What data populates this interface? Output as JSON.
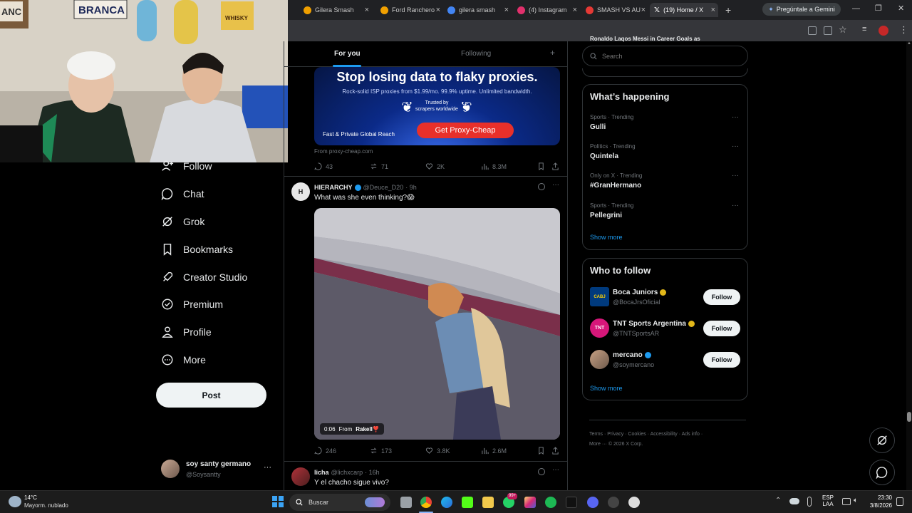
{
  "browser": {
    "tabs": [
      {
        "title": "Gilera Smash",
        "color": "#f0a000"
      },
      {
        "title": "Ford Ranchero",
        "color": "#f0a000"
      },
      {
        "title": "gilera smash",
        "color": "#4285f4"
      },
      {
        "title": "(4) Instagram",
        "color": "#e1306c"
      },
      {
        "title": "SMASH VS AU",
        "color": "#e53935"
      },
      {
        "title": "(19) Home / X",
        "color": "#ffffff"
      }
    ],
    "new_tab": "+",
    "gemini_label": "Pregúntale a Gemini",
    "window_controls": [
      "—",
      "❐",
      "✕"
    ]
  },
  "x": {
    "top_tabs": {
      "for_you": "For you",
      "following": "Following",
      "add": "+"
    },
    "nav": [
      {
        "label": "Follow",
        "icon": "person-plus-icon"
      },
      {
        "label": "Chat",
        "icon": "chat-icon"
      },
      {
        "label": "Grok",
        "icon": "grok-icon"
      },
      {
        "label": "Bookmarks",
        "icon": "bookmark-icon"
      },
      {
        "label": "Creator Studio",
        "icon": "rocket-icon"
      },
      {
        "label": "Premium",
        "icon": "verified-icon"
      },
      {
        "label": "Profile",
        "icon": "person-icon"
      },
      {
        "label": "More",
        "icon": "more-circle-icon"
      }
    ],
    "post_button": "Post",
    "account": {
      "name": "soy santy germano",
      "handle": "@Soysantty",
      "more": "···"
    },
    "ad": {
      "headline": "Stop losing data to flaky proxies.",
      "subline": "Rock-solid ISP proxies from $1.99/mo. 99.9% uptime. Unlimited bandwidth.",
      "badge_line1": "Trusted by",
      "badge_line2": "scrapers worldwide",
      "tag": "Fast & Private Global Reach",
      "cta": "Get Proxy-Cheap",
      "source": "From proxy-cheap.com",
      "replies": "43",
      "reposts": "71",
      "likes": "2K",
      "views": "8.3M"
    },
    "post1": {
      "name": "HIERARCHY",
      "handle": "@Deuce_D20",
      "time": "· 9h",
      "text": "What was she even thinking?😱",
      "video_time": "0:06",
      "video_from": "From",
      "video_source": "Rakell❣️",
      "replies": "246",
      "reposts": "173",
      "likes": "3.8K",
      "views": "2.6M"
    },
    "post2": {
      "name": "licha",
      "handle": "@lichxcarp",
      "time": "· 16h",
      "text": "Y el chacho sigue vivo?"
    },
    "search": {
      "placeholder": "Search",
      "clipped_text": "Ronaldo Laqos Messi in Career Goals as"
    },
    "happening": {
      "title": "What’s happening",
      "trends": [
        {
          "meta": "Sports · Trending",
          "name": "Gulli"
        },
        {
          "meta": "Politics · Trending",
          "name": "Quintela"
        },
        {
          "meta": "Only on X · Trending",
          "name": "#GranHermano"
        },
        {
          "meta": "Sports · Trending",
          "name": "Pellegrini"
        }
      ],
      "show_more": "Show more"
    },
    "who_to_follow": {
      "title": "Who to follow",
      "accounts": [
        {
          "name": "Boca Juniors",
          "handle": "@BocaJrsOficial",
          "verified_color": "#e2b719",
          "avatar_color": "#003a7d",
          "avatar_text": "CABJ"
        },
        {
          "name": "TNT Sports Argentina",
          "handle": "@TNTSportsAR",
          "verified_color": "#e2b719",
          "avatar_color": "#d6177a",
          "avatar_text": "TNT"
        },
        {
          "name": "mercano",
          "handle": "@soymercano",
          "verified_color": "#1d9bf0",
          "avatar_color": "#8a6b58",
          "avatar_text": ""
        }
      ],
      "follow_label": "Follow",
      "show_more": "Show more"
    },
    "footer": {
      "links": [
        "Terms",
        "Privacy",
        "Cookies",
        "Accessibility",
        "Ads info",
        "More ···"
      ],
      "copyright": "© 2026 X Corp."
    }
  },
  "taskbar": {
    "weather_temp": "14°C",
    "weather_desc": "Mayorm. nublado",
    "search_placeholder": "Buscar",
    "lang_line1": "ESP",
    "lang_line2": "LAA",
    "time": "23:30",
    "date": "3/8/2026",
    "badge_count": "99+"
  },
  "colors": {
    "accent": "#1d9bf0",
    "ad_cta": "#e8302a",
    "verified_blue": "#1d9bf0",
    "background": "#000000"
  }
}
